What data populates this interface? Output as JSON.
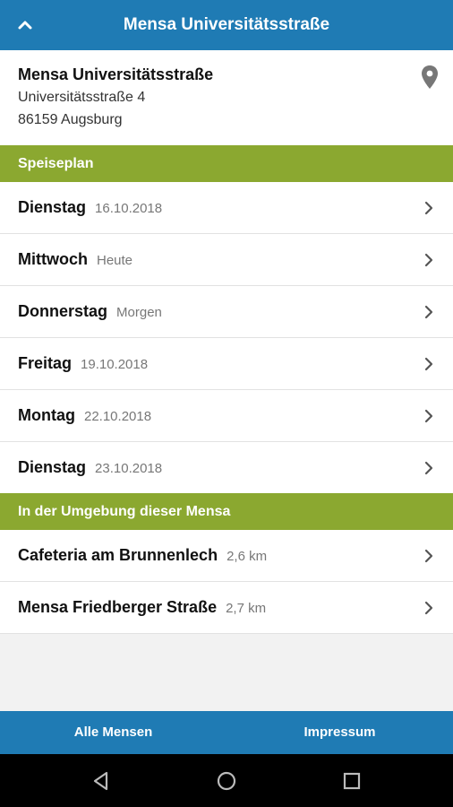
{
  "appbar": {
    "title": "Mensa Universitätsstraße"
  },
  "mensa": {
    "name": "Mensa Universitätsstraße",
    "street": "Universitätsstraße 4",
    "city": "86159 Augsburg"
  },
  "sections": {
    "menu": "Speiseplan",
    "nearby": "In der Umgebung dieser Mensa"
  },
  "days": [
    {
      "day": "Dienstag",
      "date": "16.10.2018"
    },
    {
      "day": "Mittwoch",
      "date": "Heute"
    },
    {
      "day": "Donnerstag",
      "date": "Morgen"
    },
    {
      "day": "Freitag",
      "date": "19.10.2018"
    },
    {
      "day": "Montag",
      "date": "22.10.2018"
    },
    {
      "day": "Dienstag",
      "date": "23.10.2018"
    }
  ],
  "nearby": [
    {
      "name": "Cafeteria am Brunnenlech",
      "distance": "2,6 km"
    },
    {
      "name": "Mensa Friedberger Straße",
      "distance": "2,7 km"
    }
  ],
  "bottom": {
    "all_mensen": "Alle Mensen",
    "impressum": "Impressum"
  },
  "colors": {
    "primary": "#1f7bb4",
    "section": "#8ba830"
  }
}
